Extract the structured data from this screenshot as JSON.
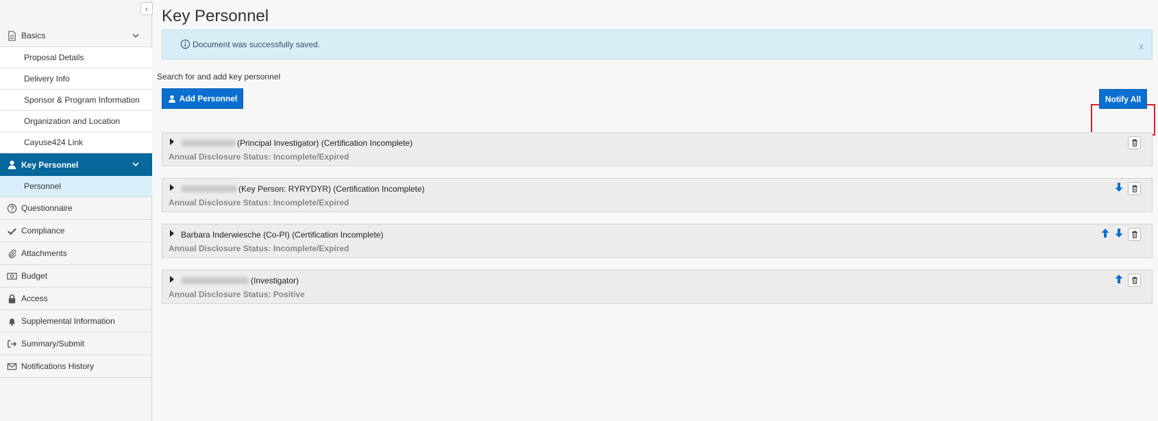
{
  "sidebar": {
    "collapse_glyph": "‹",
    "items": [
      {
        "label": "Basics",
        "icon": "document-icon"
      },
      {
        "label": "Key Personnel",
        "icon": "person-icon"
      },
      {
        "label": "Questionnaire",
        "icon": "question-icon"
      },
      {
        "label": "Compliance",
        "icon": "check-icon"
      },
      {
        "label": "Attachments",
        "icon": "paperclip-icon"
      },
      {
        "label": "Budget",
        "icon": "money-icon"
      },
      {
        "label": "Access",
        "icon": "lock-icon"
      },
      {
        "label": "Supplemental Information",
        "icon": "bell-icon"
      },
      {
        "label": "Summary/Submit",
        "icon": "sign-out-icon"
      },
      {
        "label": "Notifications History",
        "icon": "envelope-icon"
      }
    ],
    "basics_sub": [
      "Proposal Details",
      "Delivery Info",
      "Sponsor & Program Information",
      "Organization and Location",
      "Cayuse424 Link"
    ],
    "personnel_sub": [
      "Personnel"
    ]
  },
  "main": {
    "title": "Key Personnel",
    "alert": {
      "text": "Document was successfully saved.",
      "close": "x"
    },
    "search_hint": "Search for and add key personnel",
    "add_button": "Add Personnel",
    "notify_button": "Notify All",
    "personnel": [
      {
        "name_suffix": "(Principal Investigator) (Certification Incomplete)",
        "status": "Annual Disclosure Status: Incomplete/Expired"
      },
      {
        "name_suffix": "(Key Person: RYRYDYR) (Certification Incomplete)",
        "status": "Annual Disclosure Status: Incomplete/Expired"
      },
      {
        "name_suffix": "Barbara Inderwiesche (Co-PI) (Certification Incomplete)",
        "status": "Annual Disclosure Status: Incomplete/Expired"
      },
      {
        "name_suffix": "(Investigator)",
        "status": "Annual Disclosure Status: Positive"
      }
    ]
  },
  "colors": {
    "primary": "#0b6fd1",
    "active_nav": "#08679b",
    "highlight": "#e01a24"
  }
}
